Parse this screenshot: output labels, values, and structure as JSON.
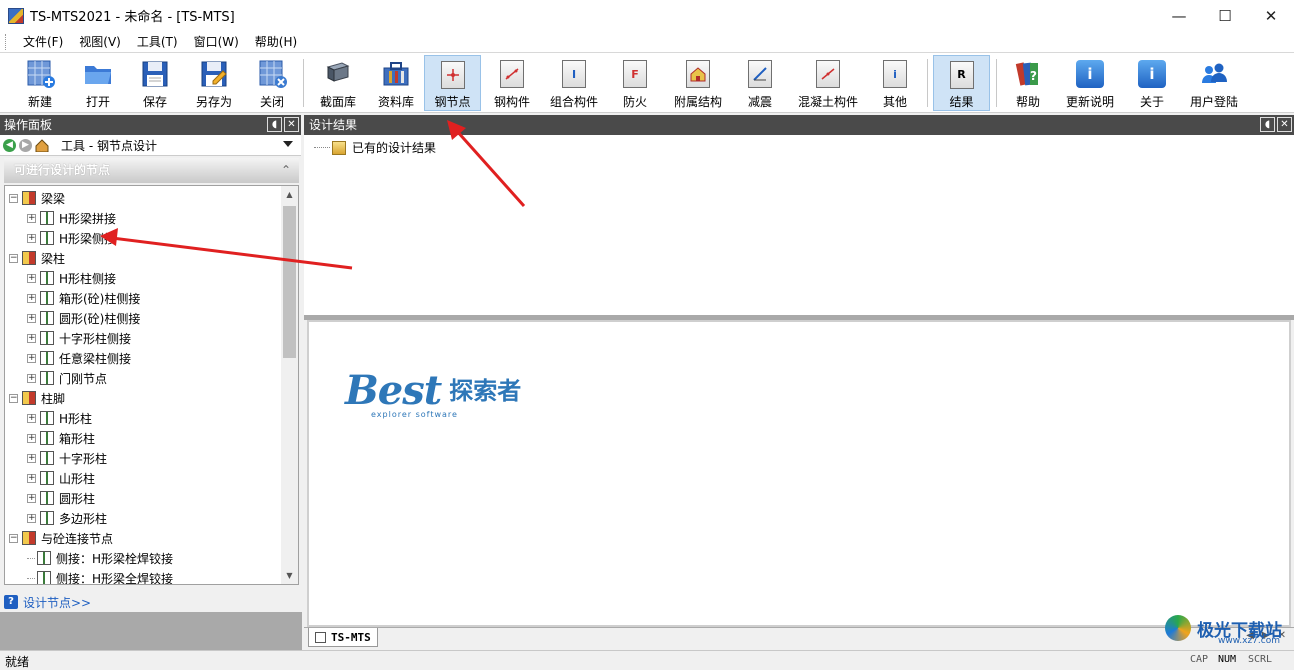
{
  "window": {
    "title": "TS-MTS2021 - 未命名 - [TS-MTS]",
    "minimize_glyph": "—",
    "maximize_glyph": "☐",
    "close_glyph": "✕"
  },
  "menu": [
    "文件(F)",
    "视图(V)",
    "工具(T)",
    "窗口(W)",
    "帮助(H)"
  ],
  "toolbar": {
    "new_label": "新建",
    "open_label": "打开",
    "save_label": "保存",
    "save_as_label": "另存为",
    "close_label": "关闭",
    "section_lib_label": "截面库",
    "material_lib_label": "资料库",
    "steel_joint_label": "钢节点",
    "steel_member_label": "钢构件",
    "composite_member_label": "组合构件",
    "fire_label": "防火",
    "auxiliary_label": "附属结构",
    "damping_label": "减震",
    "concrete_member_label": "混凝土构件",
    "other_label": "其他",
    "results_label": "结果",
    "help_label": "帮助",
    "update_notes_label": "更新说明",
    "about_label": "关于",
    "user_login_label": "用户登陆",
    "fire_icon_letter": "F",
    "results_icon_letter": "R",
    "other_icon_letter": "i",
    "composite_icon_letter": "I"
  },
  "left_panel": {
    "title": "操作面板",
    "selector_value": "工具 - 钢节点设计",
    "section_title": "可进行设计的节点",
    "link_label": "设计节点>>",
    "tree": [
      {
        "label": "梁梁",
        "level": 0,
        "expander": "−"
      },
      {
        "label": "H形梁拼接",
        "level": 1,
        "expander": "+"
      },
      {
        "label": "H形梁侧接",
        "level": 1,
        "expander": "+"
      },
      {
        "label": "梁柱",
        "level": 0,
        "expander": "−"
      },
      {
        "label": "H形柱侧接",
        "level": 1,
        "expander": "+"
      },
      {
        "label": "箱形(砼)柱侧接",
        "level": 1,
        "expander": "+"
      },
      {
        "label": "圆形(砼)柱侧接",
        "level": 1,
        "expander": "+"
      },
      {
        "label": "十字形柱侧接",
        "level": 1,
        "expander": "+"
      },
      {
        "label": "任意梁柱侧接",
        "level": 1,
        "expander": "+"
      },
      {
        "label": "门刚节点",
        "level": 1,
        "expander": "+"
      },
      {
        "label": "柱脚",
        "level": 0,
        "expander": "−"
      },
      {
        "label": "H形柱",
        "level": 1,
        "expander": "+"
      },
      {
        "label": "箱形柱",
        "level": 1,
        "expander": "+"
      },
      {
        "label": "十字形柱",
        "level": 1,
        "expander": "+"
      },
      {
        "label": "山形柱",
        "level": 1,
        "expander": "+"
      },
      {
        "label": "圆形柱",
        "level": 1,
        "expander": "+"
      },
      {
        "label": "多边形柱",
        "level": 1,
        "expander": "+"
      },
      {
        "label": "与砼连接节点",
        "level": 0,
        "expander": "−"
      },
      {
        "label": "侧接：H形梁栓焊铰接",
        "level": 1,
        "expander": ""
      },
      {
        "label": "侧接：H形梁全焊铰接",
        "level": 1,
        "expander": ""
      }
    ]
  },
  "right_panel": {
    "title": "设计结果",
    "result_item": "已有的设计结果",
    "doc_tab": "TS-MTS"
  },
  "watermark": {
    "best": "Best",
    "cn": "探索者",
    "sub": "explorer software"
  },
  "corner_watermark": {
    "text": "极光下载站",
    "url": "www.xz7.com"
  },
  "status": {
    "text": "就绪",
    "cap": "CAP",
    "num": "NUM",
    "scrl": "SCRL"
  },
  "colors": {
    "accent": "#1f5fc1",
    "panel_header": "#4a4a4a",
    "active_tool": "#cfe3f6",
    "annotation_arrow": "#e02020"
  }
}
